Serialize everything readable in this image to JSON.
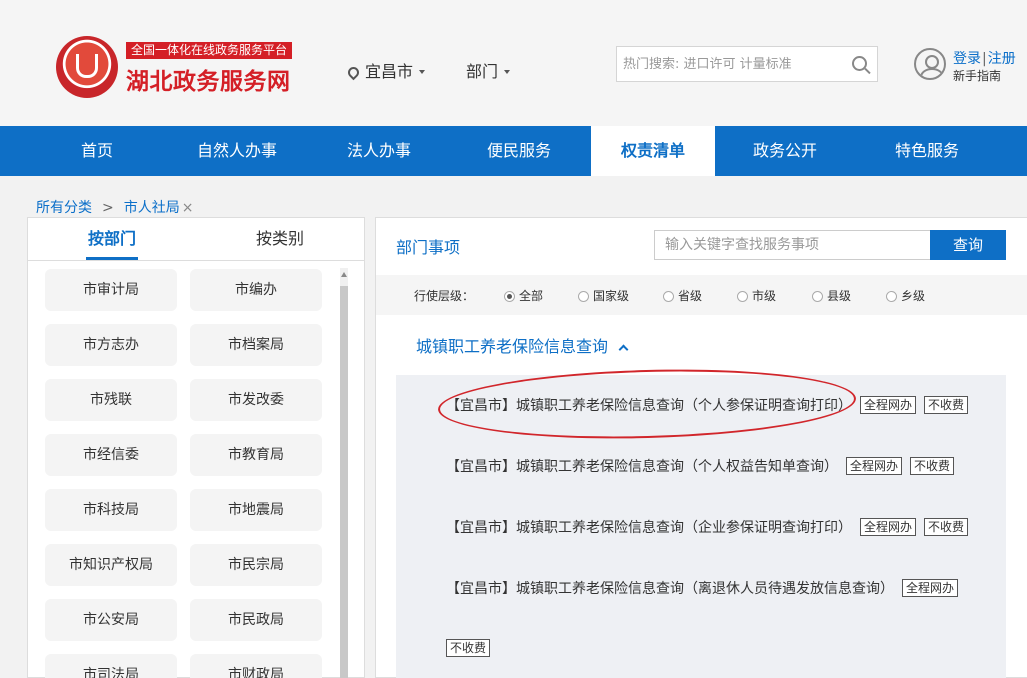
{
  "header": {
    "slogan": "全国一体化在线政务服务平台",
    "site_name": "湖北政务服务网",
    "location": "宜昌市",
    "dept_menu": "部门",
    "search_placeholder": "热门搜索: 进口许可 计量标准",
    "login": "登录",
    "separator": "|",
    "register": "注册",
    "guide": "新手指南"
  },
  "nav": {
    "items": [
      {
        "label": "首页"
      },
      {
        "label": "自然人办事"
      },
      {
        "label": "法人办事"
      },
      {
        "label": "便民服务"
      },
      {
        "label": "权责清单"
      },
      {
        "label": "政务公开"
      },
      {
        "label": "特色服务"
      }
    ],
    "active": "权责清单"
  },
  "breadcrumb": {
    "root": "所有分类",
    "sep": ">",
    "current": "市人社局",
    "close": "×"
  },
  "left": {
    "tabs": [
      {
        "label": "按部门"
      },
      {
        "label": "按类别"
      }
    ],
    "depts": [
      "市审计局",
      "市编办",
      "市方志办",
      "市档案局",
      "市残联",
      "市发改委",
      "市经信委",
      "市教育局",
      "市科技局",
      "市地震局",
      "市知识产权局",
      "市民宗局",
      "市公安局",
      "市民政局",
      "市司法局",
      "市财政局"
    ]
  },
  "right": {
    "title": "部门事项",
    "keyword_placeholder": "输入关键字查找服务事项",
    "query_button": "查询",
    "filter_label": "行使层级：",
    "levels": [
      "全部",
      "国家级",
      "省级",
      "市级",
      "县级",
      "乡级"
    ],
    "selected_level": "全部",
    "group_title": "城镇职工养老保险信息查询",
    "items": [
      {
        "text": "【宜昌市】城镇职工养老保险信息查询（个人参保证明查询打印）",
        "tags": [
          "全程网办",
          "不收费"
        ]
      },
      {
        "text": "【宜昌市】城镇职工养老保险信息查询（个人权益告知单查询）",
        "tags": [
          "全程网办",
          "不收费"
        ]
      },
      {
        "text": "【宜昌市】城镇职工养老保险信息查询（企业参保证明查询打印）",
        "tags": [
          "全程网办",
          "不收费"
        ]
      },
      {
        "text": "【宜昌市】城镇职工养老保险信息查询（离退休人员待遇发放信息查询）",
        "tags": [
          "全程网办"
        ]
      }
    ],
    "trailing_tag": "不收费"
  },
  "colors": {
    "brand_red": "#d41f26",
    "nav_blue": "#0e6fc6",
    "annotation_red": "#d1262b"
  }
}
